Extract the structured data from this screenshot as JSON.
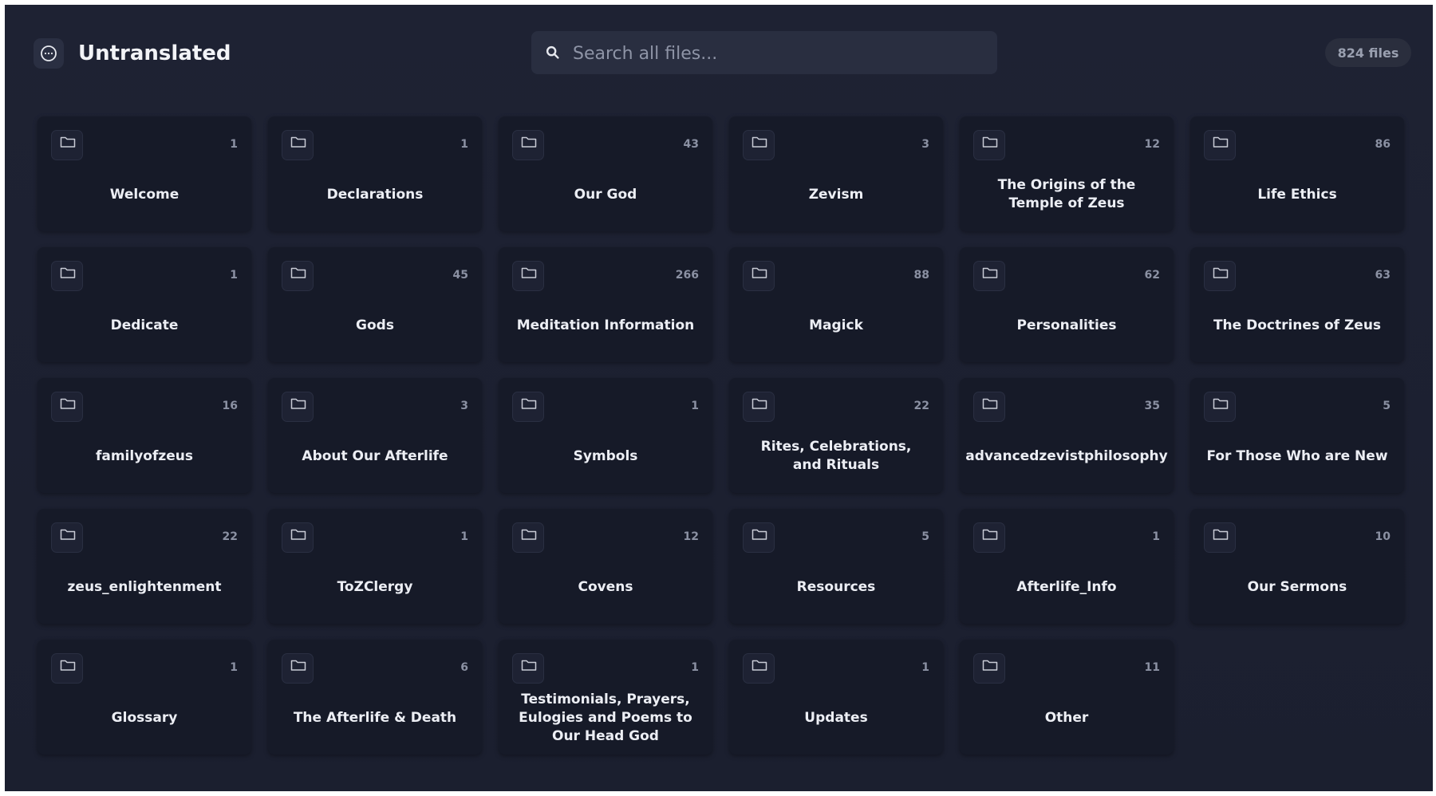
{
  "header": {
    "title": "Untranslated",
    "app_icon": "translate-bubble-icon",
    "search_placeholder": "Search all files...",
    "search_value": "",
    "search_icon": "search-icon",
    "file_count": "824 files"
  },
  "colors": {
    "background": "#1e2233",
    "card": "#161a28",
    "text": "#eceef4",
    "muted": "#8b91a3"
  },
  "folders": [
    {
      "name": "Welcome",
      "count": "1",
      "icon": "folder-icon"
    },
    {
      "name": "Declarations",
      "count": "1",
      "icon": "folder-icon"
    },
    {
      "name": "Our God",
      "count": "43",
      "icon": "folder-icon"
    },
    {
      "name": "Zevism",
      "count": "3",
      "icon": "folder-icon"
    },
    {
      "name": "The Origins of the Temple of Zeus",
      "count": "12",
      "icon": "folder-icon"
    },
    {
      "name": "Life Ethics",
      "count": "86",
      "icon": "folder-icon"
    },
    {
      "name": "Dedicate",
      "count": "1",
      "icon": "folder-icon"
    },
    {
      "name": "Gods",
      "count": "45",
      "icon": "folder-icon"
    },
    {
      "name": "Meditation Information",
      "count": "266",
      "icon": "folder-icon"
    },
    {
      "name": "Magick",
      "count": "88",
      "icon": "folder-icon"
    },
    {
      "name": "Personalities",
      "count": "62",
      "icon": "folder-icon"
    },
    {
      "name": "The Doctrines of Zeus",
      "count": "63",
      "icon": "folder-icon"
    },
    {
      "name": "familyofzeus",
      "count": "16",
      "icon": "folder-icon"
    },
    {
      "name": "About Our Afterlife",
      "count": "3",
      "icon": "folder-icon"
    },
    {
      "name": "Symbols",
      "count": "1",
      "icon": "folder-icon"
    },
    {
      "name": "Rites, Celebrations, and Rituals",
      "count": "22",
      "icon": "folder-icon"
    },
    {
      "name": "advancedzevistphilosophy",
      "count": "35",
      "icon": "folder-icon"
    },
    {
      "name": "For Those Who are New",
      "count": "5",
      "icon": "folder-icon"
    },
    {
      "name": "zeus_enlightenment",
      "count": "22",
      "icon": "folder-icon"
    },
    {
      "name": "ToZClergy",
      "count": "1",
      "icon": "folder-icon"
    },
    {
      "name": "Covens",
      "count": "12",
      "icon": "folder-icon"
    },
    {
      "name": "Resources",
      "count": "5",
      "icon": "folder-icon"
    },
    {
      "name": "Afterlife_Info",
      "count": "1",
      "icon": "folder-icon"
    },
    {
      "name": "Our Sermons",
      "count": "10",
      "icon": "folder-icon"
    },
    {
      "name": "Glossary",
      "count": "1",
      "icon": "folder-icon"
    },
    {
      "name": "The Afterlife & Death",
      "count": "6",
      "icon": "folder-icon"
    },
    {
      "name": "Testimonials, Prayers, Eulogies and Poems to Our Head God",
      "count": "1",
      "icon": "folder-icon"
    },
    {
      "name": "Updates",
      "count": "1",
      "icon": "folder-icon"
    },
    {
      "name": "Other",
      "count": "11",
      "icon": "folder-icon"
    }
  ]
}
